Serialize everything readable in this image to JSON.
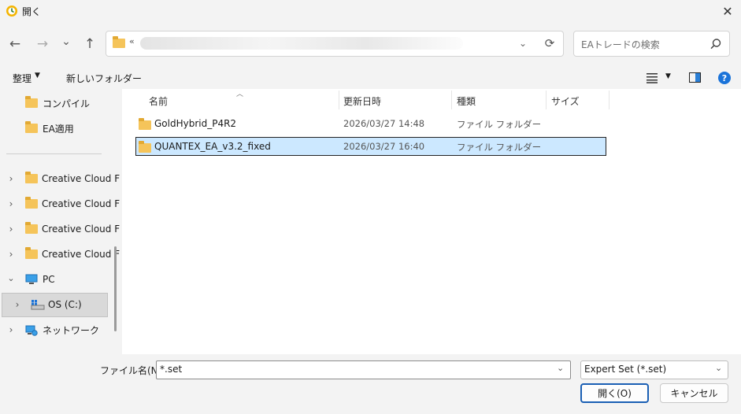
{
  "window": {
    "title": "開く",
    "close_glyph": "✕"
  },
  "nav": {
    "back_glyph": "←",
    "forward_glyph": "→",
    "recent_glyph": "⌄",
    "up_glyph": "↑",
    "address_prefix": "«",
    "refresh_glyph": "⟳",
    "search_placeholder": "EAトレードの検索"
  },
  "toolbar": {
    "organize_label": "整理",
    "new_folder_label": "新しいフォルダー"
  },
  "sidebar": {
    "items": [
      {
        "label": "コンパイル",
        "icon": "folder-icon"
      },
      {
        "label": "EA適用",
        "icon": "folder-icon"
      },
      {
        "label": "Creative Cloud F",
        "icon": "folder-icon"
      },
      {
        "label": "Creative Cloud F",
        "icon": "folder-icon"
      },
      {
        "label": "Creative Cloud F",
        "icon": "folder-icon"
      },
      {
        "label": "Creative Cloud F",
        "icon": "folder-icon"
      },
      {
        "label": "PC",
        "icon": "pc-icon"
      },
      {
        "label": "OS (C:)",
        "icon": "drive-icon"
      },
      {
        "label": "ネットワーク",
        "icon": "network-icon"
      }
    ]
  },
  "columns": {
    "name": "名前",
    "modified": "更新日時",
    "type": "種類",
    "size": "サイズ"
  },
  "files": [
    {
      "name": "GoldHybrid_P4R2",
      "modified": "2026/03/27 14:48",
      "type": "ファイル フォルダー"
    },
    {
      "name": "QUANTEX_EA_v3.2_fixed",
      "modified": "2026/03/27 16:40",
      "type": "ファイル フォルダー"
    }
  ],
  "bottom": {
    "filename_label": "ファイル名(N):",
    "filename_value": "*.set",
    "filter_value": "Expert Set (*.set)",
    "open_label": "開く(O)",
    "cancel_label": "キャンセル"
  },
  "colors": {
    "selection": "#cce8ff",
    "folder": "#f5c45a",
    "accent": "#1a5fb4"
  }
}
